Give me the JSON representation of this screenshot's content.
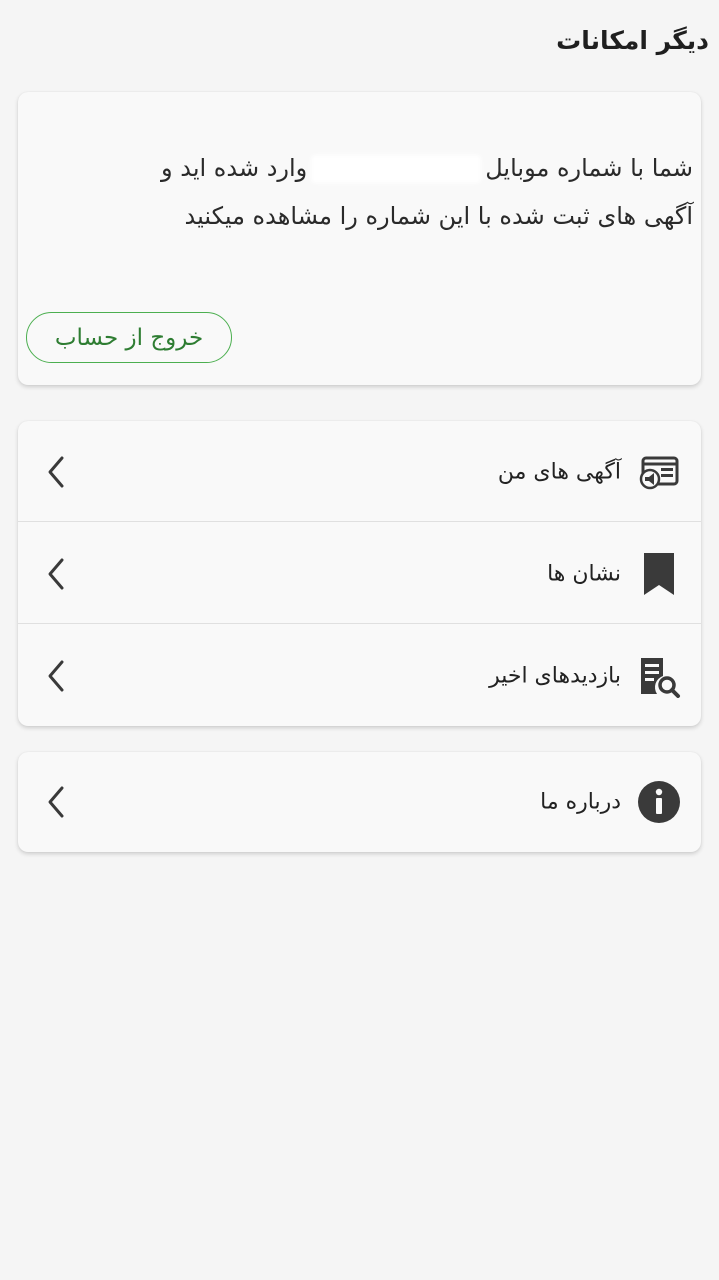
{
  "header": {
    "title": "دیگر امکانات"
  },
  "account": {
    "message_line1_start": "شما با شماره موبایل",
    "message_line1_end": "وارد شده اید و",
    "message_line2": "آگهی های ثبت شده با این شماره را مشاهده میکنید",
    "logout_label": "خروج از حساب"
  },
  "menu": {
    "items": [
      {
        "label": "آگهی های من",
        "icon": "ads-icon"
      },
      {
        "label": "نشان ها",
        "icon": "bookmark-icon"
      },
      {
        "label": "بازدیدهای اخیر",
        "icon": "recent-views-icon"
      }
    ]
  },
  "about": {
    "label": "درباره ما",
    "icon": "info-icon"
  },
  "colors": {
    "background": "#f5f5f5",
    "card": "#f9f9f9",
    "accent_green": "#4caf50",
    "accent_green_text": "#2e7d32",
    "icon_dark": "#3a3a3a"
  }
}
